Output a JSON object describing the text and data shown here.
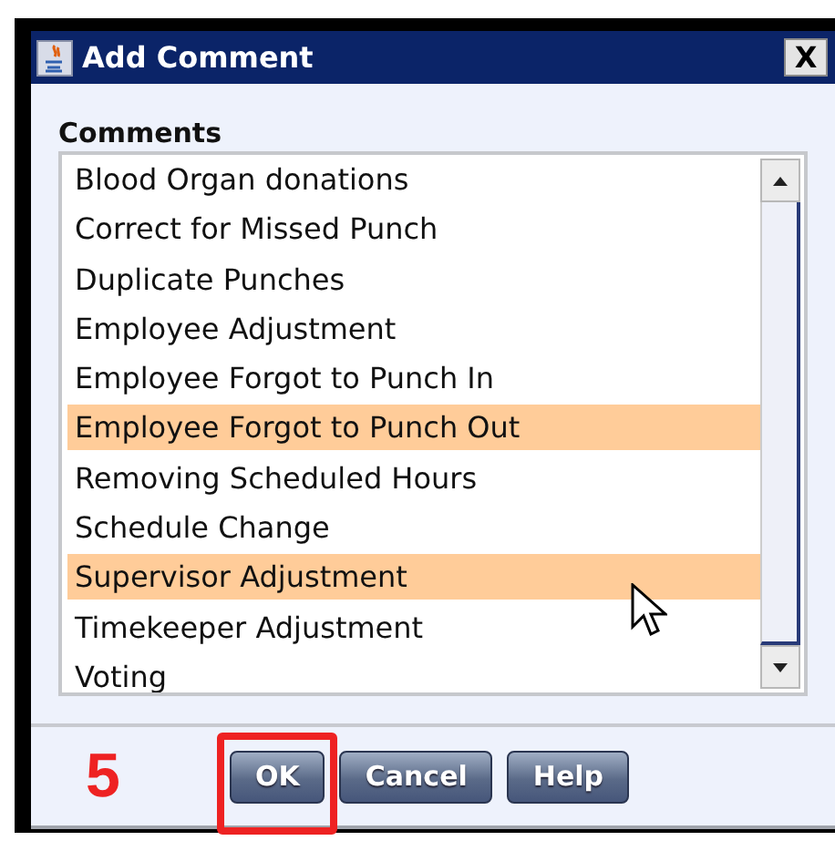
{
  "window": {
    "title": "Add Comment",
    "close": "X"
  },
  "comments": {
    "label": "Comments",
    "items": [
      {
        "label": "Blood Organ donations",
        "selected": false
      },
      {
        "label": "Correct for Missed Punch",
        "selected": false
      },
      {
        "label": "Duplicate Punches",
        "selected": false
      },
      {
        "label": "Employee Adjustment",
        "selected": false
      },
      {
        "label": "Employee Forgot to Punch In",
        "selected": false
      },
      {
        "label": "Employee Forgot to Punch Out",
        "selected": true
      },
      {
        "label": "Removing Scheduled Hours",
        "selected": false
      },
      {
        "label": "Schedule Change",
        "selected": false
      },
      {
        "label": "Supervisor Adjustment",
        "selected": true
      },
      {
        "label": "Timekeeper Adjustment",
        "selected": false
      },
      {
        "label": "Voting",
        "selected": false
      }
    ]
  },
  "step_number": "5",
  "buttons": [
    {
      "label": "OK",
      "highlighted": true
    },
    {
      "label": "Cancel",
      "highlighted": false
    },
    {
      "label": "Help",
      "highlighted": false
    }
  ]
}
